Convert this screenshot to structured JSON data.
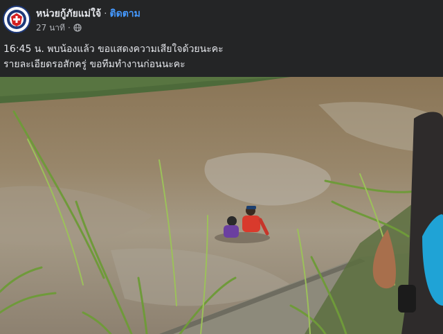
{
  "header": {
    "page_name": "หน่วยกู้ภัยแม่ใจ้",
    "separator": "·",
    "follow_label": "ติดตาม",
    "time_ago": "27 นาที",
    "meta_separator": "·",
    "privacy_icon": "globe-icon"
  },
  "post": {
    "line1": "16:45 น. พบน้องแล้ว ขอแสดงความเสียใจด้วยนะคะ",
    "line2": "รายละเอียดรอสักครู่ ขอทีมทำงานก่อนนะคะ"
  },
  "photo": {
    "subject": "rescue-workers-in-canal"
  },
  "colors": {
    "background": "#242526",
    "text": "#e4e6eb",
    "secondary_text": "#b0b3b8",
    "link": "#4599ff"
  }
}
